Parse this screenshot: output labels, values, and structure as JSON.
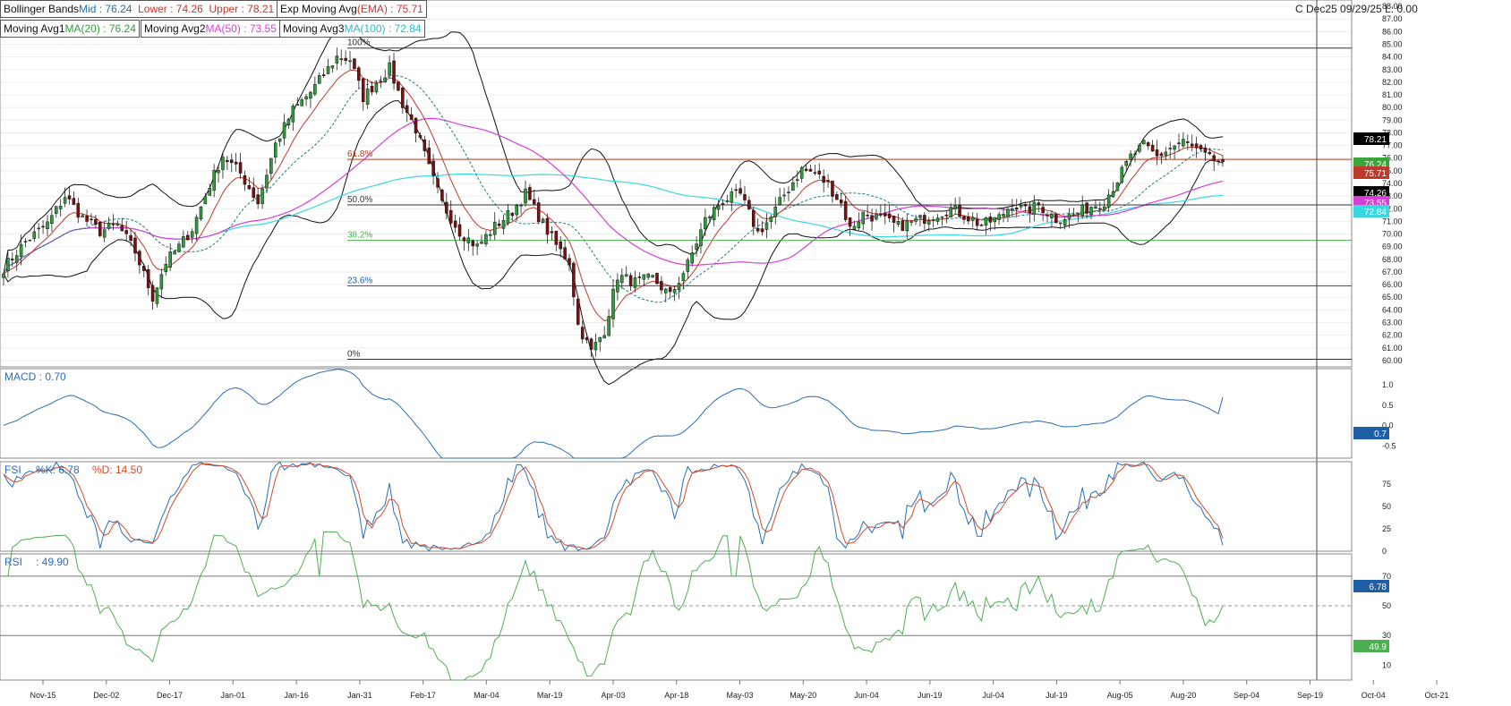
{
  "symbol_line": "C Dec25 09/29/25 L: 0.00",
  "indicators": {
    "bollinger": {
      "name": "Bollinger Bands",
      "mid_label": "Mid : 76.24",
      "lower_label": "Lower : 74.26",
      "upper_label": "Upper : 78.21"
    },
    "ema": {
      "name": "Exp Moving Avg",
      "value_label": "(EMA) : 75.71"
    },
    "ma1": {
      "name": "Moving Avg1",
      "value_label": "MA(20) : 76.24"
    },
    "ma2": {
      "name": "Moving Avg2",
      "value_label": "MA(50) : 73.55"
    },
    "ma3": {
      "name": "Moving Avg3",
      "value_label": "MA(100) : 72.84"
    }
  },
  "fib_levels": [
    {
      "label": "100%",
      "price": 84.7,
      "color": "#333333"
    },
    {
      "label": "61.8%",
      "price": 75.9,
      "color": "#b04020"
    },
    {
      "label": "50.0%",
      "price": 72.3,
      "color": "#333333"
    },
    {
      "label": "38.2%",
      "price": 69.5,
      "color": "#4caf50"
    },
    {
      "label": "23.6%",
      "price": 65.9,
      "color": "#2060b0"
    },
    {
      "label": "0%",
      "price": 60.1,
      "color": "#333333"
    }
  ],
  "macd": {
    "label": "MACD : 0.70",
    "value_badge": "0.7",
    "ticks": [
      "1.0",
      "0.5",
      "0.0",
      "-0.5"
    ]
  },
  "stoch": {
    "label": "FSI",
    "k_label": "%K: 6.78",
    "d_label": "%D: 14.50",
    "value_badge": "6.78",
    "ticks": [
      "75",
      "50",
      "25",
      "0"
    ]
  },
  "rsi": {
    "label": "RSI",
    "value_label": ": 49.90",
    "value_badge": "49.9",
    "ticks": [
      "70",
      "50",
      "30",
      "10"
    ]
  },
  "price_badges": {
    "upper": "78.21",
    "ema": "75.71",
    "ma1": "76.24",
    "lower": "74.26",
    "ma2": "73.55",
    "ma3": "72.84"
  },
  "colors": {
    "up": "#2e9e3a",
    "down": "#7a1010",
    "ema": "#c0392b",
    "ma1": "#1e7d7d",
    "ma2": "#d63fd6",
    "ma3": "#37d8e0",
    "bb": "#111111",
    "macd": "#2a6db5",
    "stoch_d": "#d24a2a",
    "rsi": "#4caf50"
  },
  "chart_data": {
    "type": "candlestick",
    "x_tick_labels": [
      "Nov-15",
      "Dec-02",
      "Dec-17",
      "Jan-01",
      "Jan-16",
      "Jan-31",
      "Feb-17",
      "Mar-04",
      "Mar-19",
      "Apr-03",
      "Apr-18",
      "May-03",
      "May-20",
      "Jun-04",
      "Jun-19",
      "Jul-04",
      "Jul-19",
      "Aug-05",
      "Aug-20",
      "Sep-04",
      "Sep-19",
      "Oct-04",
      "Oct-21"
    ],
    "y_ticks": [
      60,
      61,
      62,
      63,
      64,
      65,
      66,
      67,
      68,
      69,
      70,
      71,
      72,
      73,
      74,
      75,
      76,
      77,
      78,
      79,
      80,
      81,
      82,
      83,
      84,
      85,
      86,
      87,
      88
    ],
    "ylim": [
      59.5,
      88.5
    ],
    "close_path": [
      [
        0,
        67.3
      ],
      [
        5,
        69.4
      ],
      [
        10,
        70.8
      ],
      [
        14,
        73.0
      ],
      [
        18,
        71.3
      ],
      [
        22,
        70.2
      ],
      [
        26,
        70.7
      ],
      [
        30,
        68.6
      ],
      [
        34,
        65.0
      ],
      [
        37,
        67.8
      ],
      [
        40,
        69.0
      ],
      [
        43,
        70.4
      ],
      [
        47,
        73.9
      ],
      [
        50,
        76.2
      ],
      [
        54,
        74.8
      ],
      [
        58,
        72.5
      ],
      [
        62,
        77.1
      ],
      [
        66,
        79.8
      ],
      [
        70,
        81.2
      ],
      [
        73,
        82.6
      ],
      [
        76,
        84.0
      ],
      [
        79,
        83.8
      ],
      [
        82,
        80.8
      ],
      [
        85,
        82.0
      ],
      [
        88,
        83.1
      ],
      [
        91,
        80.3
      ],
      [
        94,
        78.3
      ],
      [
        97,
        75.2
      ],
      [
        100,
        72.4
      ],
      [
        104,
        70.2
      ],
      [
        108,
        69.0
      ],
      [
        112,
        70.6
      ],
      [
        116,
        71.8
      ],
      [
        119,
        73.2
      ],
      [
        122,
        71.4
      ],
      [
        126,
        69.1
      ],
      [
        129,
        67.8
      ],
      [
        131,
        62.8
      ],
      [
        134,
        60.7
      ],
      [
        137,
        62.4
      ],
      [
        140,
        66.7
      ],
      [
        144,
        66.2
      ],
      [
        148,
        66.5
      ],
      [
        152,
        65.1
      ],
      [
        156,
        67.6
      ],
      [
        160,
        71.1
      ],
      [
        164,
        72.7
      ],
      [
        168,
        73.1
      ],
      [
        172,
        70.1
      ],
      [
        175,
        71.3
      ],
      [
        178,
        73.1
      ],
      [
        182,
        75.1
      ],
      [
        185,
        74.8
      ],
      [
        188,
        73.9
      ],
      [
        191,
        72.4
      ],
      [
        193,
        70.4
      ],
      [
        196,
        71.6
      ],
      [
        200,
        71.2
      ],
      [
        204,
        70.6
      ],
      [
        208,
        71.0
      ],
      [
        212,
        71.5
      ],
      [
        216,
        72.0
      ],
      [
        220,
        71.3
      ],
      [
        223,
        70.7
      ],
      [
        227,
        71.3
      ],
      [
        230,
        72.4
      ],
      [
        233,
        71.8
      ],
      [
        236,
        72.3
      ],
      [
        240,
        71.2
      ],
      [
        244,
        71.5
      ],
      [
        248,
        72.2
      ],
      [
        251,
        72.6
      ],
      [
        254,
        74.3
      ],
      [
        257,
        76.1
      ],
      [
        260,
        77.0
      ],
      [
        263,
        76.1
      ],
      [
        266,
        76.8
      ],
      [
        269,
        77.3
      ],
      [
        272,
        76.6
      ],
      [
        275,
        75.9
      ],
      [
        278,
        75.7
      ]
    ],
    "candle_count": 279,
    "price_last": 75.71,
    "bollinger_upper_last": 78.21,
    "bollinger_mid_last": 76.24,
    "bollinger_lower_last": 74.26,
    "ema_last": 75.71,
    "ma20_last": 76.24,
    "ma50_last": 73.55,
    "ma100_last": 72.84,
    "macd_last": 0.7,
    "stoch_k_last": 6.78,
    "stoch_d_last": 14.5,
    "rsi_last": 49.9
  }
}
